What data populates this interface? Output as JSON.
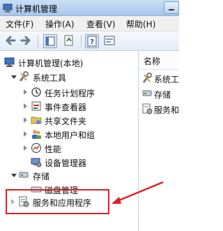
{
  "window": {
    "title": "计算机管理"
  },
  "menu": {
    "items": [
      "文件(F)",
      "操作(A)",
      "查看(V)",
      "帮助(H)"
    ]
  },
  "tree": {
    "root": "计算机管理(本地)",
    "system_tools": "系统工具",
    "items": [
      "任务计划程序",
      "事件查看器",
      "共享文件夹",
      "本地用户和组",
      "性能",
      "设备管理器"
    ],
    "storage": "存储",
    "disk": "磁盘管理",
    "services": "服务和应用程序"
  },
  "right": {
    "header": "名称",
    "items": [
      "系统工",
      "存储",
      "服务和"
    ]
  },
  "annotation": {
    "color": "#e02020"
  }
}
